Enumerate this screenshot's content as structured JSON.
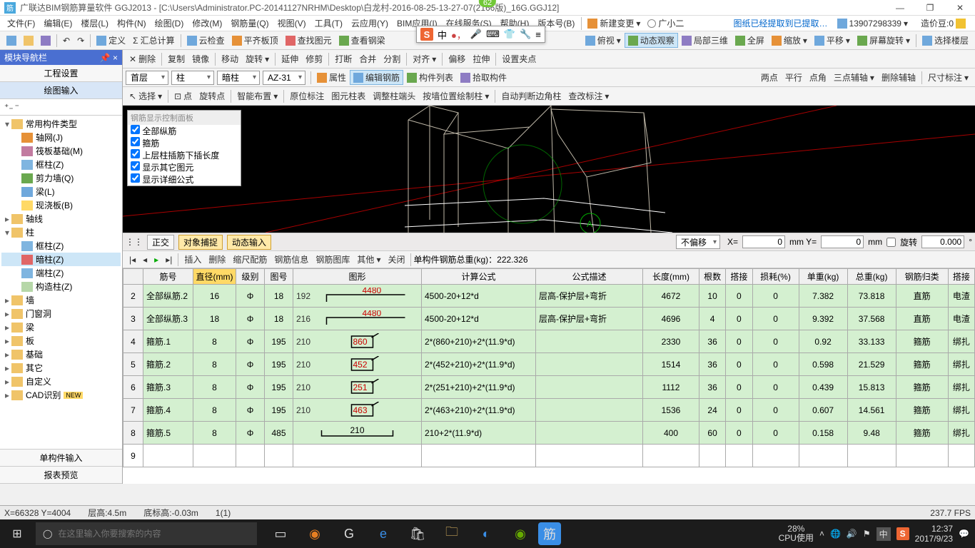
{
  "badge_top": "62",
  "title": "广联达BIM钢筋算量软件 GGJ2013 - [C:\\Users\\Administrator.PC-20141127NRHM\\Desktop\\白龙村-2016-08-25-13-27-07(2166版)_16G.GGJ12]",
  "menus": [
    "文件(F)",
    "编辑(E)",
    "楼层(L)",
    "构件(N)",
    "绘图(D)",
    "修改(M)",
    "钢筋量(Q)",
    "视图(V)",
    "工具(T)",
    "云应用(Y)",
    "BIM应用(I)",
    "在线服务(S)",
    "帮助(H)",
    "版本号(B)"
  ],
  "menu_new": "新建变更",
  "menu_person": "广小二",
  "menu_tip": "图纸已经提取到已提取…",
  "user_id": "13907298339",
  "coin_label": "造价豆:0",
  "toolbar1": {
    "定义": "定义",
    "汇总": "汇总计算",
    "云检查": "云检查",
    "平齐板顶": "平齐板顶",
    "查找图元": "查找图元",
    "查看钢梁": "查看钢梁",
    "俯视": "俯视",
    "动态观察": "动态观察",
    "局部三维": "局部三维",
    "全屏": "全屏",
    "缩放": "缩放",
    "平移": "平移",
    "屏幕旋转": "屏幕旋转",
    "选择楼层": "选择楼层"
  },
  "toolbar2": {
    "删除": "删除",
    "复制": "复制",
    "镜像": "镜像",
    "移动": "移动",
    "旋转": "旋转",
    "延伸": "延伸",
    "修剪": "修剪",
    "打断": "打断",
    "合并": "合并",
    "分割": "分割",
    "对齐": "对齐",
    "偏移": "偏移",
    "拉伸": "拉伸",
    "设置夹点": "设置夹点"
  },
  "combos": {
    "floor": "首层",
    "type": "柱",
    "sub": "暗柱",
    "name": "AZ-31"
  },
  "view_tb": {
    "属性": "属性",
    "编辑钢筋": "编辑钢筋",
    "构件列表": "构件列表",
    "拾取构件": "拾取构件",
    "两点": "两点",
    "平行": "平行",
    "点角": "点角",
    "三点梳轴": "三点辅轴",
    "删辅轴": "删除辅轴",
    "尺寸": "尺寸标注"
  },
  "view_tb2": {
    "选择": "选择",
    "点": "点",
    "旋转点": "旋转点",
    "智能布置": "智能布置",
    "原位标注": "原位标注",
    "图元柱表": "图元柱表",
    "调整柱端头": "调整柱端头",
    "按墙位置绘制柱": "按墙位置绘制柱",
    "自动判断边角柱": "自动判断边角柱",
    "查改标注": "查改标注"
  },
  "nav": {
    "title": "模块导航栏",
    "tab1": "工程设置",
    "tab2": "绘图输入"
  },
  "tree": {
    "root": "常用构件类型",
    "轴网": "轴网(J)",
    "筏板基础": "筏板基础(M)",
    "框柱": "框柱(Z)",
    "剪力墙": "剪力墙(Q)",
    "梁": "梁(L)",
    "现浇板": "现浇板(B)",
    "轴线": "轴线",
    "柱": "柱",
    "框柱Z": "框柱(Z)",
    "暗柱Z": "暗柱(Z)",
    "端柱Z": "端柱(Z)",
    "构造柱": "构造柱(Z)",
    "墙": "墙",
    "门窗洞": "门窗洞",
    "梁2": "梁",
    "板": "板",
    "基础": "基础",
    "其它": "其它",
    "自定义": "自定义",
    "CAD识别": "CAD识别"
  },
  "nav_bottom": {
    "单构件输入": "单构件输入",
    "报表预览": "报表预览"
  },
  "rebar_panel": {
    "hdr": "钢筋显示控制面板",
    "o1": "全部纵筋",
    "o2": "箍筋",
    "o3": "上层柱插筋下插长度",
    "o4": "显示其它图元",
    "o5": "显示详细公式"
  },
  "status": {
    "正交": "正交",
    "对象捕捉": "对象捕捉",
    "动态输入": "动态输入",
    "不偏移": "不偏移",
    "X": "X=",
    "Y": "mm Y=",
    "mm": "mm",
    "旋转": "旋转",
    "xval": "0",
    "yval": "0",
    "rot": "0.000"
  },
  "tbl_toolbar": {
    "插入": "插入",
    "删除": "删除",
    "缩尺配筋": "缩尺配筋",
    "钢筋信息": "钢筋信息",
    "钢筋图库": "钢筋图库",
    "其他": "其他",
    "关闭": "关闭",
    "total_label": "单构件钢筋总重(kg)：",
    "total": "222.326"
  },
  "headers": [
    "",
    "筋号",
    "直径(mm)",
    "级别",
    "图号",
    "图形",
    "计算公式",
    "公式描述",
    "长度(mm)",
    "根数",
    "搭接",
    "损耗(%)",
    "单重(kg)",
    "总重(kg)",
    "钢筋归类",
    "搭接"
  ],
  "rows": [
    {
      "n": "2",
      "id": "全部纵筋.2",
      "dia": "16",
      "lvl": "Φ",
      "pic": "18",
      "shape_l": "192",
      "shape_top": "4480",
      "formula": "4500-20+12*d",
      "desc": "层高-保护层+弯折",
      "len": "4672",
      "cnt": "10",
      "tj": "0",
      "loss": "0",
      "uw": "7.382",
      "tw": "73.818",
      "cat": "直筋",
      "rt": "电渣"
    },
    {
      "n": "3",
      "id": "全部纵筋.3",
      "dia": "18",
      "lvl": "Φ",
      "pic": "18",
      "shape_l": "216",
      "shape_top": "4480",
      "formula": "4500-20+12*d",
      "desc": "层高-保护层+弯折",
      "len": "4696",
      "cnt": "4",
      "tj": "0",
      "loss": "0",
      "uw": "9.392",
      "tw": "37.568",
      "cat": "直筋",
      "rt": "电渣"
    },
    {
      "n": "4",
      "id": "箍筋.1",
      "dia": "8",
      "lvl": "Φ",
      "pic": "195",
      "shape_l": "210",
      "shape_top": "860",
      "formula": "2*(860+210)+2*(11.9*d)",
      "desc": "",
      "len": "2330",
      "cnt": "36",
      "tj": "0",
      "loss": "0",
      "uw": "0.92",
      "tw": "33.133",
      "cat": "箍筋",
      "rt": "绑扎"
    },
    {
      "n": "5",
      "id": "箍筋.2",
      "dia": "8",
      "lvl": "Φ",
      "pic": "195",
      "shape_l": "210",
      "shape_top": "452",
      "formula": "2*(452+210)+2*(11.9*d)",
      "desc": "",
      "len": "1514",
      "cnt": "36",
      "tj": "0",
      "loss": "0",
      "uw": "0.598",
      "tw": "21.529",
      "cat": "箍筋",
      "rt": "绑扎"
    },
    {
      "n": "6",
      "id": "箍筋.3",
      "dia": "8",
      "lvl": "Φ",
      "pic": "195",
      "shape_l": "210",
      "shape_top": "251",
      "formula": "2*(251+210)+2*(11.9*d)",
      "desc": "",
      "len": "1112",
      "cnt": "36",
      "tj": "0",
      "loss": "0",
      "uw": "0.439",
      "tw": "15.813",
      "cat": "箍筋",
      "rt": "绑扎"
    },
    {
      "n": "7",
      "id": "箍筋.4",
      "dia": "8",
      "lvl": "Φ",
      "pic": "195",
      "shape_l": "210",
      "shape_top": "463",
      "formula": "2*(463+210)+2*(11.9*d)",
      "desc": "",
      "len": "1536",
      "cnt": "24",
      "tj": "0",
      "loss": "0",
      "uw": "0.607",
      "tw": "14.561",
      "cat": "箍筋",
      "rt": "绑扎"
    },
    {
      "n": "8",
      "id": "箍筋.5",
      "dia": "8",
      "lvl": "Φ",
      "pic": "485",
      "shape_l": "",
      "shape_top": "210",
      "formula": "210+2*(11.9*d)",
      "desc": "",
      "len": "400",
      "cnt": "60",
      "tj": "0",
      "loss": "0",
      "uw": "0.158",
      "tw": "9.48",
      "cat": "箍筋",
      "rt": "绑扎"
    }
  ],
  "empty_row": "9",
  "bottom_status": {
    "coord": "X=66328 Y=4004",
    "层高": "层高:4.5m",
    "底标高": "底标高:-0.03m",
    "sel": "1(1)",
    "fps": "237.7 FPS"
  },
  "taskbar": {
    "search_ph": "在这里输入你要搜索的内容",
    "cpu_pct": "28%",
    "cpu_lbl": "CPU使用",
    "ime": "中",
    "time": "12:37",
    "date": "2017/9/23"
  }
}
